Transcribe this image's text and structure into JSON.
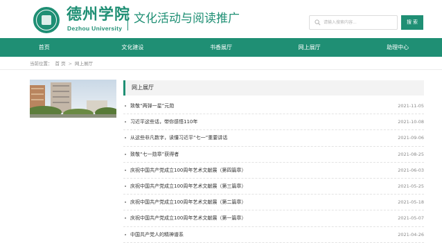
{
  "header": {
    "logo_name": "德州学院",
    "logo_en": "Dezhou University",
    "site_title": "文化活动与阅读推广",
    "search": {
      "placeholder": "请输入搜索内容...",
      "button_label": "搜 索",
      "icon": "search-icon"
    }
  },
  "nav": {
    "items": [
      "首页",
      "文化建设",
      "书香展厅",
      "网上展厅",
      "助理中心"
    ]
  },
  "breadcrumb": {
    "prefix": "当前位置：",
    "home": "首 页",
    "separator": ">",
    "current": "网上展厅"
  },
  "panel": {
    "title": "网上展厅"
  },
  "news": [
    {
      "title": "致敬“两弹一星”元勋",
      "date": "2021-11-05"
    },
    {
      "title": "习近平这些话，带你感悟110年",
      "date": "2021-10-08"
    },
    {
      "title": "从这些非凡数字，读懂习近平“七一”重要讲话",
      "date": "2021-09-06"
    },
    {
      "title": "致敬“七一勋章”获得者",
      "date": "2021-08-25"
    },
    {
      "title": "庆祝中国共产党成立100周年艺术文献展（第四篇章）",
      "date": "2021-06-03"
    },
    {
      "title": "庆祝中国共产党成立100周年艺术文献展（第三篇章）",
      "date": "2021-05-25"
    },
    {
      "title": "庆祝中国共产党成立100周年艺术文献展（第二篇章）",
      "date": "2021-05-18"
    },
    {
      "title": "庆祝中国共产党成立100周年艺术文献展（第一篇章）",
      "date": "2021-05-07"
    },
    {
      "title": "中国共产党人的精神谱系",
      "date": "2021-04-26"
    }
  ],
  "colors": {
    "brand": "#1f8f74",
    "nav_text": "#ffffff",
    "date": "#888888"
  }
}
